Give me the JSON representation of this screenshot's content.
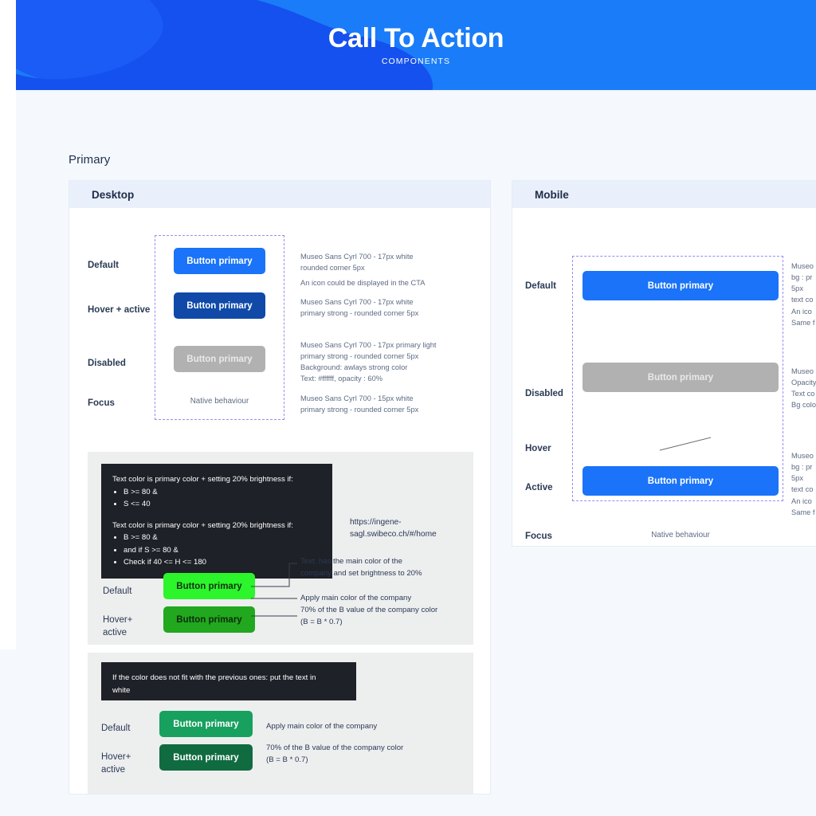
{
  "banner": {
    "title": "Call To Action",
    "subtitle": "COMPONENTS",
    "bg_color": "#1a7cf8",
    "blob_color_dark": "#1551ef",
    "blob_color_mid": "#1a5cf5"
  },
  "section": {
    "label": "Primary"
  },
  "colors": {
    "primary": "#1a73f8",
    "primary_strong": "#1049a8",
    "disabled_grey": "#b1b1b1",
    "green_bright": "#2cf52c",
    "green_bright_hover": "#21a81f",
    "green_solid": "#17a05e",
    "green_solid_hover": "#106b40",
    "dashed_border": "#9a8cf0",
    "note_bg": "#1e2127"
  },
  "desktop": {
    "panel_title": "Desktop",
    "rows": [
      {
        "state": "Default",
        "button_label": "Button primary",
        "spec": "Museo Sans Cyrl 700 - 17px white\nrounded corner 5px",
        "spec2": "An icon could be displayed in the CTA"
      },
      {
        "state": "Hover + active",
        "button_label": "Button primary",
        "spec": "Museo Sans Cyrl 700 - 17px white\nprimary strong - rounded corner 5px"
      },
      {
        "state": "Disabled",
        "button_label": "Button primary",
        "spec": "Museo Sans Cyrl 700 - 17px primary light\nprimary strong - rounded corner 5px\nBackground: awlays strong color\nText: #ffffff, opacity : 60%"
      },
      {
        "state": "Focus",
        "button_label": "Native behaviour",
        "spec": "Museo Sans Cyrl 700 - 15px white\nprimary strong - rounded corner 5px"
      }
    ]
  },
  "mobile": {
    "panel_title": "Mobile",
    "rows": [
      {
        "state": "Default",
        "button_label": "Button primary",
        "spec": "Museo\nbg : pr\n5px\ntext co\nAn ico\nSame f"
      },
      {
        "state": "Disabled",
        "button_label": "Button primary",
        "spec": "Museo\nOpacity\nText co\nBg colo"
      },
      {
        "state": "Hover",
        "button_label": "",
        "spec": ""
      },
      {
        "state": "Active",
        "button_label": "Button primary",
        "spec": "Museo\nbg : pr\n5px\ntext co\nAn ico\nSame f"
      },
      {
        "state": "Focus",
        "button_label": "Native behaviour",
        "spec": ""
      }
    ]
  },
  "brightness_note": {
    "rule1_title": "Text color is primary color + setting 20% brightness if:",
    "rule1_items": [
      "B >= 80 &",
      "S <= 40"
    ],
    "rule2_title": "Text color is primary color + setting 20% brightness if:",
    "rule2_items": [
      "B >= 80 &",
      "and if S >= 80 &",
      "Check if 40 <= H <= 180"
    ],
    "url": "https://ingene-\nsagl.swibeco.ch/#/home"
  },
  "green_block": {
    "rows": [
      {
        "state": "Default",
        "button_label": "Button primary",
        "annotation_top": "Text: has the main color of the\ncompany and set brightness to 20%",
        "annotation_bottom": "Apply main color of the company"
      },
      {
        "state": "Hover+\nactive",
        "button_label": "Button primary",
        "annotation": "70% of the B value of the company color\n(B = B * 0.7)"
      }
    ]
  },
  "white_text_block": {
    "note": "If the color does not fit with the previous ones: put the text in\nwhite",
    "rows": [
      {
        "state": "Default",
        "button_label": "Button primary",
        "annotation": "Apply main color of the company"
      },
      {
        "state": "Hover+\nactive",
        "button_label": "Button primary",
        "annotation": "70% of the B value of the company color\n(B = B * 0.7)"
      }
    ]
  }
}
